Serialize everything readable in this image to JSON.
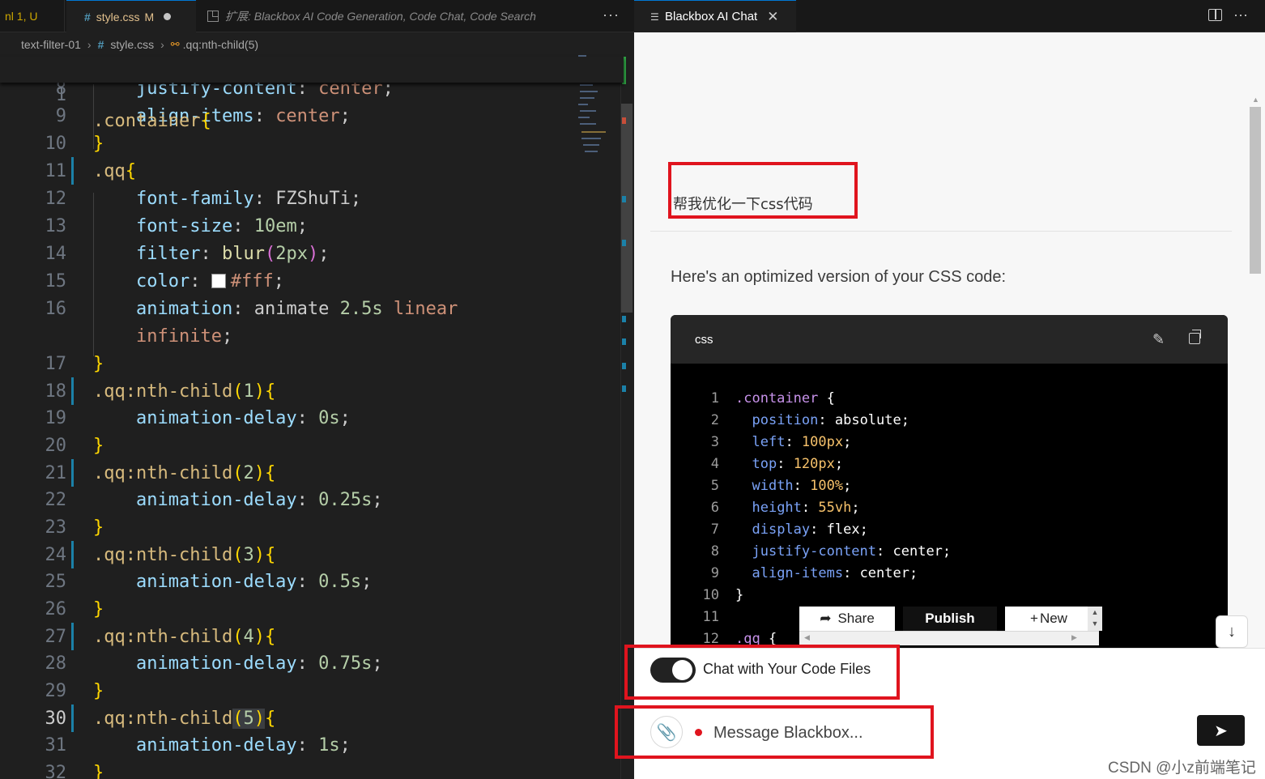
{
  "editor": {
    "tabs": [
      {
        "label": "nl 1, U"
      },
      {
        "icon": "#",
        "label": "style.css",
        "flag": "M"
      },
      {
        "label": "扩展: Blackbox AI Code Generation, Code Chat, Code Search"
      }
    ],
    "more": "···",
    "breadcrumb": {
      "folder": "text-filter-01",
      "hash": "#",
      "file": "style.css",
      "symbol": ".qq:nth-child(5)"
    },
    "sticky": {
      "number": "1",
      "selector": ".container",
      "brace": "{"
    },
    "lines": [
      {
        "n": "8",
        "prop": "justify-content",
        "value": "center"
      },
      {
        "n": "9",
        "prop": "align-items",
        "value": "center"
      },
      {
        "n": "10",
        "close": "}"
      },
      {
        "n": "11",
        "selector": ".qq",
        "brace": "{"
      },
      {
        "n": "12",
        "prop": "font-family",
        "value": "FZShuTi"
      },
      {
        "n": "13",
        "prop": "font-size",
        "value": "10em"
      },
      {
        "n": "14",
        "prop": "filter",
        "fn": "blur",
        "arg": "2px"
      },
      {
        "n": "15",
        "prop": "color",
        "value": "#fff"
      },
      {
        "n": "16",
        "prop": "animation",
        "v1": "animate",
        "v2": "2.5s",
        "v3": "linear",
        "wrap": "infinite"
      },
      {
        "n": "17",
        "close": "}"
      },
      {
        "n": "18",
        "selector": ".qq:nth-child",
        "arg": "1",
        "brace": "{"
      },
      {
        "n": "19",
        "prop": "animation-delay",
        "value": "0s"
      },
      {
        "n": "20",
        "close": "}"
      },
      {
        "n": "21",
        "selector": ".qq:nth-child",
        "arg": "2",
        "brace": "{"
      },
      {
        "n": "22",
        "prop": "animation-delay",
        "value": "0.25s"
      },
      {
        "n": "23",
        "close": "}"
      },
      {
        "n": "24",
        "selector": ".qq:nth-child",
        "arg": "3",
        "brace": "{"
      },
      {
        "n": "25",
        "prop": "animation-delay",
        "value": "0.5s"
      },
      {
        "n": "26",
        "close": "}"
      },
      {
        "n": "27",
        "selector": ".qq:nth-child",
        "arg": "4",
        "brace": "{"
      },
      {
        "n": "28",
        "prop": "animation-delay",
        "value": "0.75s"
      },
      {
        "n": "29",
        "close": "}"
      },
      {
        "n": "30",
        "selector": ".qq:nth-child",
        "arg": "5",
        "brace": "{"
      },
      {
        "n": "31",
        "prop": "animation-delay",
        "value": "1s"
      },
      {
        "n": "32",
        "close": "}"
      }
    ]
  },
  "chat": {
    "tab_label": "Blackbox AI Chat",
    "tab_close": "✕",
    "more": "···",
    "user_message": "帮我优化一下css代码",
    "bot_message": "Here's an optimized version of your CSS code:",
    "codeblock": {
      "lang": "css",
      "lines": [
        {
          "n": "1",
          "selector": ".container",
          "brace": "{"
        },
        {
          "n": "2",
          "prop": "position",
          "value": "absolute"
        },
        {
          "n": "3",
          "prop": "left",
          "num": "100px"
        },
        {
          "n": "4",
          "prop": "top",
          "num": "120px"
        },
        {
          "n": "5",
          "prop": "width",
          "num": "100%"
        },
        {
          "n": "6",
          "prop": "height",
          "num": "55vh"
        },
        {
          "n": "7",
          "prop": "display",
          "value": "flex"
        },
        {
          "n": "8",
          "prop": "justify-content",
          "value": "center"
        },
        {
          "n": "9",
          "prop": "align-items",
          "value": "center"
        },
        {
          "n": "10",
          "close": "}"
        },
        {
          "n": "11"
        },
        {
          "n": "12",
          "selector": ".qq",
          "brace": "{"
        }
      ]
    },
    "toolbar": {
      "share": "Share",
      "publish": "Publish",
      "new": "New"
    },
    "toggle_label": "Chat with Your Code Files",
    "input_placeholder": "Message Blackbox...",
    "watermark": "CSDN @小z前端笔记"
  },
  "colors": {
    "highlight_box": "#e0141e",
    "editor_bg": "#1f1f1f",
    "chat_bg": "#f7f7f7"
  }
}
